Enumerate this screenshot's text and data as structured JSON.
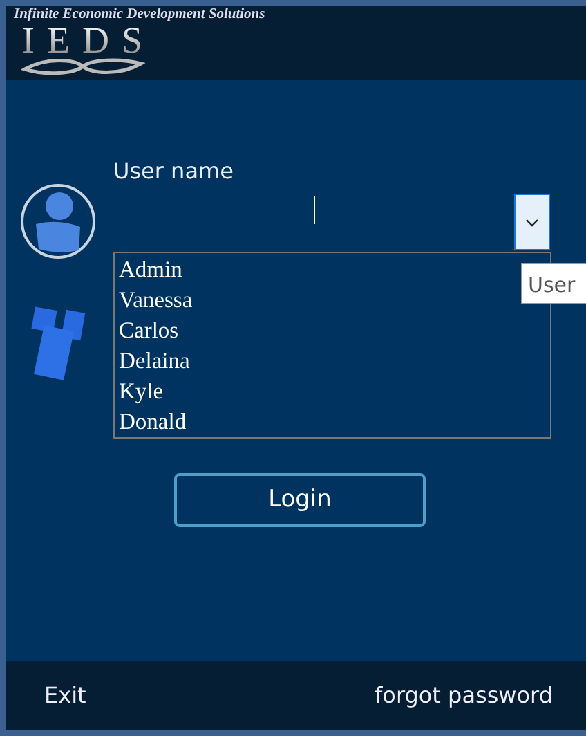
{
  "header": {
    "tagline": "Infinite Economic Development Solutions",
    "logo_text": "IEDS"
  },
  "username": {
    "label": "User name",
    "expanded": true,
    "tooltip": "User",
    "options": [
      "Admin",
      "Vanessa",
      "Carlos",
      "Delaina",
      "Kyle",
      "Donald"
    ]
  },
  "login_button": "Login",
  "footer": {
    "exit": "Exit",
    "forgot": "forgot password"
  }
}
